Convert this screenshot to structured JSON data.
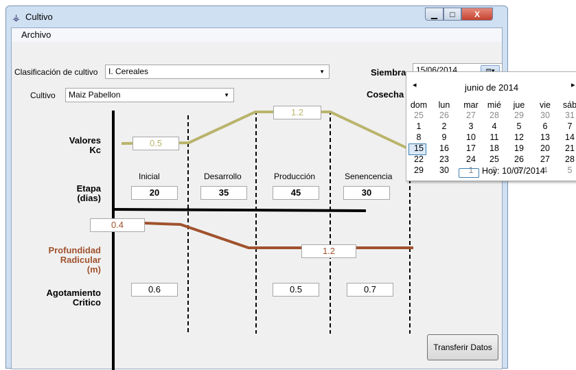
{
  "window": {
    "title": "Cultivo",
    "close_label": "X"
  },
  "menu": {
    "archivo": "Archivo"
  },
  "form": {
    "clasificacion_label": "Clasificación de cultivo",
    "clasificacion_value": "I. Cereales",
    "cultivo_label": "Cultivo",
    "cultivo_value": "Maiz Pabellon",
    "siembra_label": "Siembra",
    "siembra_value": "15/06/2014",
    "cosecha_label": "Cosecha"
  },
  "chart": {
    "kc_label_1": "Valores",
    "kc_label_2": "Kc",
    "kc_values": [
      "0.5",
      "1.2"
    ],
    "etapa_label_1": "Etapa",
    "etapa_label_2": "(dias)",
    "stages": [
      {
        "name": "Inicial",
        "days": "20"
      },
      {
        "name": "Desarrollo",
        "days": "35"
      },
      {
        "name": "Producción",
        "days": "45"
      },
      {
        "name": "Senencencia",
        "days": "30"
      }
    ],
    "prof_label_1": "Profundidad",
    "prof_label_2": "Radicular",
    "prof_label_3": "(m)",
    "root_values": [
      "0.4",
      "1.2"
    ],
    "agot_label_1": "Agotamiento",
    "agot_label_2": "Critico",
    "agot_values": [
      "0.6",
      "0.5",
      "0.7"
    ],
    "kc_color": "#b9b46c",
    "root_color": "#a0522d"
  },
  "button": {
    "transfer": "Transferir Datos"
  },
  "calendar": {
    "month_title": "junio de 2014",
    "prev": "◂",
    "next": "▸",
    "day_headers": [
      "dom",
      "lun",
      "mar",
      "mié",
      "jue",
      "vie",
      "sáb"
    ],
    "weeks": [
      [
        "25",
        "26",
        "27",
        "28",
        "29",
        "30",
        "31"
      ],
      [
        "1",
        "2",
        "3",
        "4",
        "5",
        "6",
        "7"
      ],
      [
        "8",
        "9",
        "10",
        "11",
        "12",
        "13",
        "14"
      ],
      [
        "15",
        "16",
        "17",
        "18",
        "19",
        "20",
        "21"
      ],
      [
        "22",
        "23",
        "24",
        "25",
        "26",
        "27",
        "28"
      ],
      [
        "29",
        "30",
        "1",
        "2",
        "3",
        "4",
        "5"
      ]
    ],
    "selected": "15",
    "today": "Hoy: 10/07/2014"
  }
}
